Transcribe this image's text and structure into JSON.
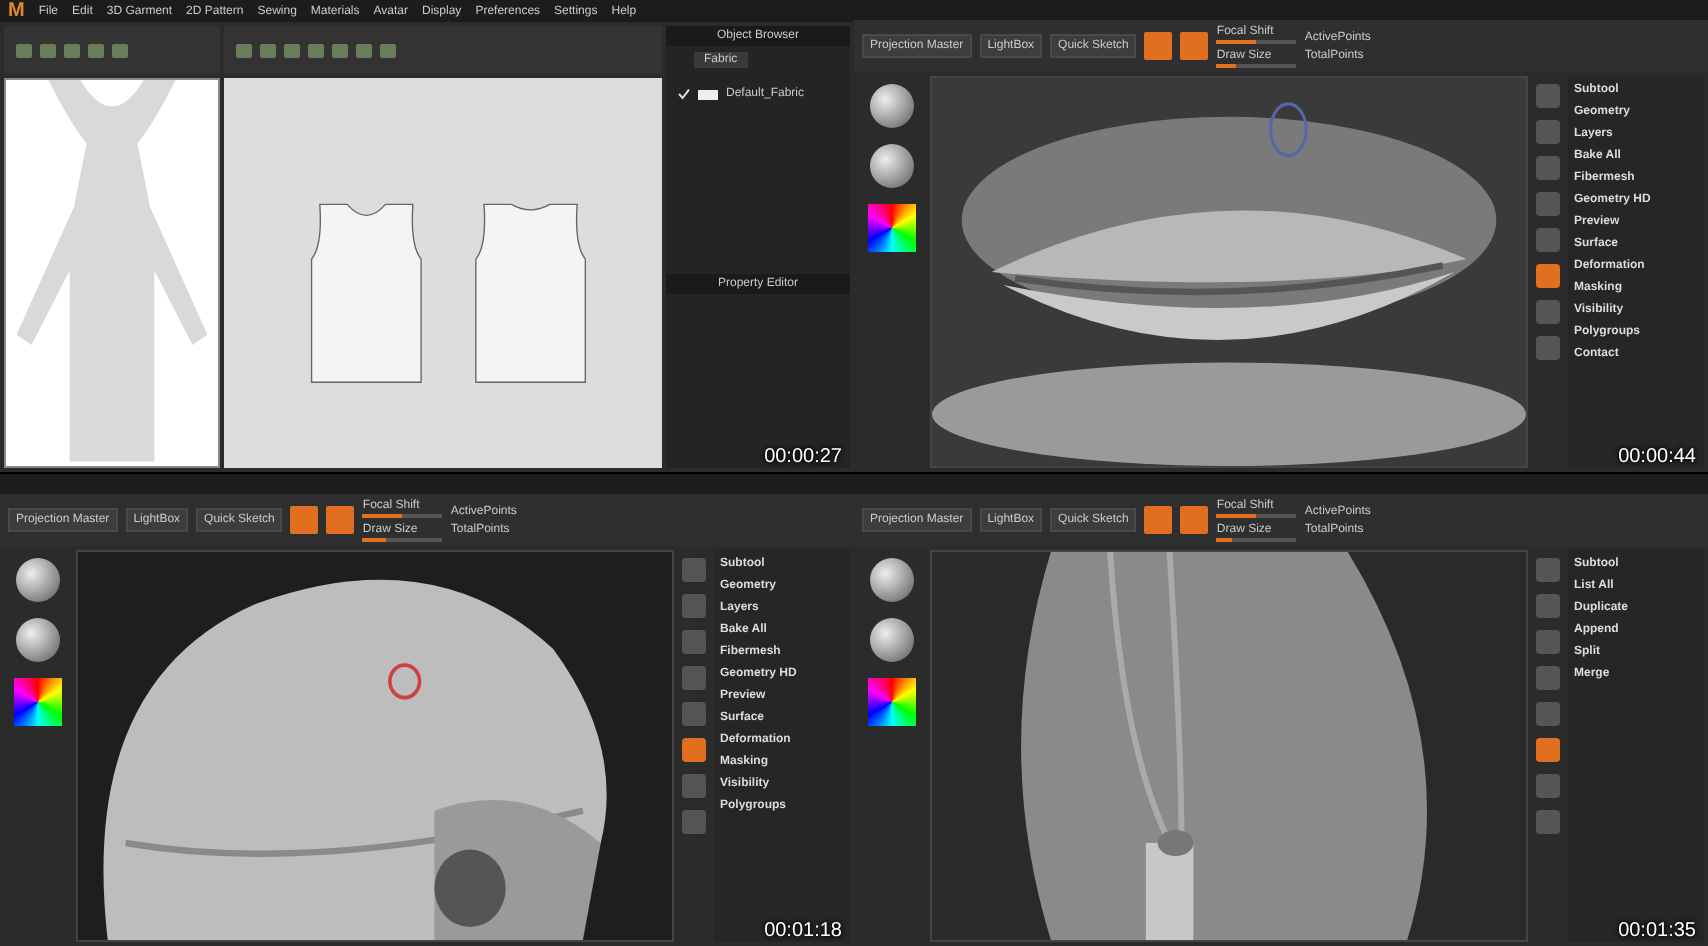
{
  "panels": [
    {
      "kind": "garment",
      "timestamp": "00:00:27",
      "logo": "M",
      "menu": [
        "File",
        "Edit",
        "3D Garment",
        "2D Pattern",
        "Sewing",
        "Materials",
        "Avatar",
        "Display",
        "Preferences",
        "Settings",
        "Help"
      ],
      "browser": {
        "title": "Object Browser",
        "tab": "Fabric",
        "items": [
          {
            "label": "Default_Fabric",
            "checked": true
          }
        ]
      },
      "property_title": "Property Editor"
    },
    {
      "kind": "sculpt",
      "timestamp": "00:00:44",
      "toolbar": [
        "Projection Master",
        "LightBox",
        "Quick Sketch"
      ],
      "fields": [
        {
          "label": "Focal Shift",
          "level": 0.5
        },
        {
          "label": "Draw Size",
          "level": 0.25
        }
      ],
      "stats": [
        "ActivePoints",
        "TotalPoints"
      ],
      "menu": [
        "Subtool",
        "Geometry",
        "Layers",
        "Bake All",
        "Fibermesh",
        "Geometry HD",
        "Preview",
        "Surface",
        "Deformation",
        "Masking",
        "Visibility",
        "Polygroups",
        "Contact"
      ]
    },
    {
      "kind": "sculpt",
      "timestamp": "00:01:18",
      "toolbar": [
        "Projection Master",
        "LightBox",
        "Quick Sketch"
      ],
      "fields": [
        {
          "label": "Focal Shift",
          "level": 0.5
        },
        {
          "label": "Draw Size",
          "level": 0.3
        }
      ],
      "stats": [
        "ActivePoints",
        "TotalPoints"
      ],
      "menu": [
        "Subtool",
        "Geometry",
        "Layers",
        "Bake All",
        "Fibermesh",
        "Geometry HD",
        "Preview",
        "Surface",
        "Deformation",
        "Masking",
        "Visibility",
        "Polygroups"
      ]
    },
    {
      "kind": "sculpt",
      "timestamp": "00:01:35",
      "toolbar": [
        "Projection Master",
        "LightBox",
        "Quick Sketch"
      ],
      "fields": [
        {
          "label": "Focal Shift",
          "level": 0.5
        },
        {
          "label": "Draw Size",
          "level": 0.2
        }
      ],
      "stats": [
        "ActivePoints",
        "TotalPoints"
      ],
      "menu": [
        "Subtool",
        "List All",
        "Duplicate",
        "Append",
        "Split",
        "Merge"
      ]
    }
  ]
}
